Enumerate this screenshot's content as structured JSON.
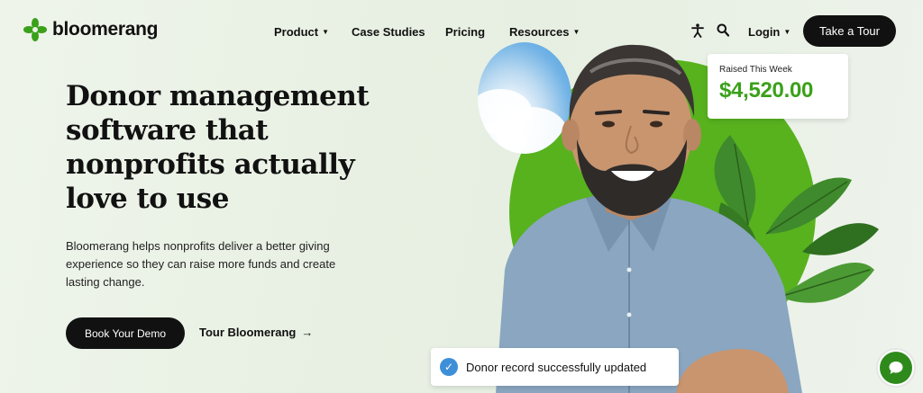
{
  "brand": {
    "name": "bloomerang",
    "color": "#3aa11a"
  },
  "nav": {
    "product": "Product",
    "case_studies": "Case Studies",
    "pricing": "Pricing",
    "resources": "Resources",
    "login": "Login",
    "caret": "▼"
  },
  "header": {
    "cta": "Take a Tour"
  },
  "hero": {
    "title": "Donor management software that nonprofits actually love to use",
    "subtitle": "Bloomerang helps nonprofits deliver a better giving experience so they can raise more funds and create lasting change.",
    "primary_button": "Book Your Demo",
    "secondary_link": "Tour Bloomerang",
    "secondary_arrow": "→"
  },
  "stat_card": {
    "label": "Raised This Week",
    "value": "$4,520.00"
  },
  "toast": {
    "check": "✓",
    "message": "Donor record successfully updated"
  },
  "icons": {
    "accessibility": "accessibility-icon",
    "search": "search-icon",
    "chat": "chat-icon",
    "logo": "flower-logo-icon"
  },
  "colors": {
    "accent_green": "#57b21e",
    "dark": "#111111",
    "toast_check": "#3f8fd8"
  }
}
